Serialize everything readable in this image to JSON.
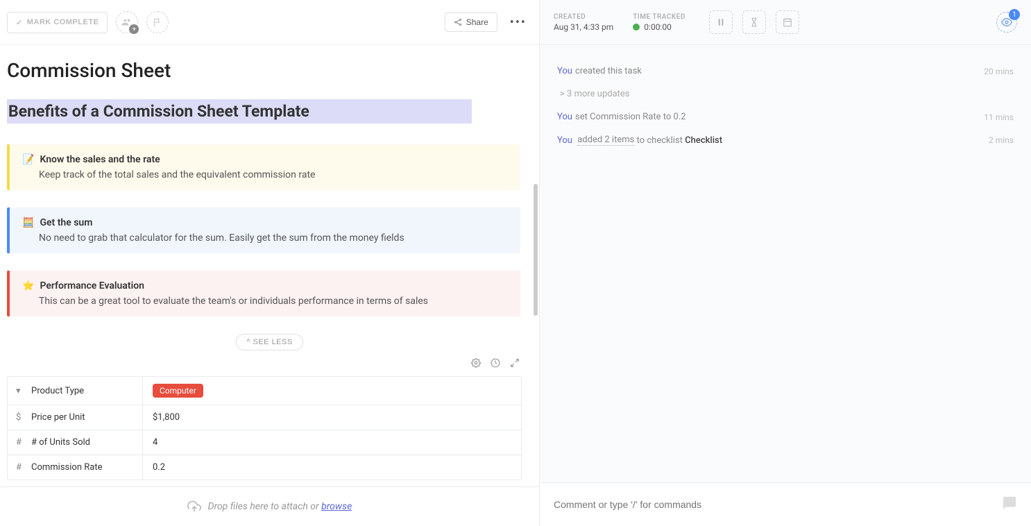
{
  "header": {
    "mark_complete": "MARK COMPLETE",
    "share": "Share"
  },
  "page": {
    "title": "Commission Sheet",
    "section_heading": "Benefits of a Commission Sheet Template"
  },
  "callouts": [
    {
      "emoji": "📝",
      "title": "Know the sales and the rate",
      "text": "Keep track of the total sales and the equivalent commission rate"
    },
    {
      "emoji": "🧮",
      "title": "Get the sum",
      "text": "No need to grab that calculator for the sum. Easily get the sum from the money fields"
    },
    {
      "emoji": "⭐",
      "title": "Performance Evaluation",
      "text": "This can be a great tool to evaluate the team's or individuals performance in terms of sales"
    }
  ],
  "see_less": "^ SEE LESS",
  "fields": [
    {
      "icon": "dropdown",
      "label": "Product Type",
      "value": "Computer",
      "is_tag": true
    },
    {
      "icon": "dollar",
      "label": "Price per Unit",
      "value": "$1,800"
    },
    {
      "icon": "hash",
      "label": "# of Units Sold",
      "value": "4"
    },
    {
      "icon": "hash",
      "label": "Commission Rate",
      "value": "0.2"
    }
  ],
  "dropzone": {
    "text": "Drop files here to attach or ",
    "link": "browse"
  },
  "meta": {
    "created_label": "CREATED",
    "created_value": "Aug 31, 4:33 pm",
    "time_label": "TIME TRACKED",
    "time_value": "0:00:00",
    "watch_count": "1"
  },
  "activity": [
    {
      "user": "You",
      "text": " created this task",
      "time": "20 mins"
    }
  ],
  "more_updates": "> 3 more updates",
  "activity2": [
    {
      "user": "You",
      "text": " set Commission Rate to 0.2",
      "time": "11 mins"
    }
  ],
  "activity3": {
    "user": "You",
    "linked": "added 2 items",
    "mid": " to checklist ",
    "bold": "Checklist",
    "time": "2 mins"
  },
  "comment_placeholder": "Comment or type '/' for commands"
}
